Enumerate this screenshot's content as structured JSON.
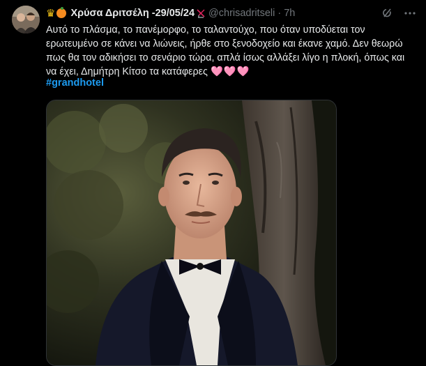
{
  "tweet": {
    "display_name": "Χρύσα Δριτσέλη -29/05/24",
    "handle": "@chrisadritseli",
    "separator": "·",
    "time": "7h",
    "emojis": [
      "crown",
      "orange",
      "no-sign"
    ],
    "text": "Αυτό το πλάσμα, το πανέμορφο, το ταλαντούχο, που όταν υποδύεται τον ερωτευμένο σε κάνει να λιώνεις, ήρθε στο ξενοδοχείο και έκανε χαμό. Δεν θεωρώ πως θα τον αδικήσει το σενάριο τώρα, απλά ίσως αλλάξει λίγο η πλοκή, όπως και να έχει, Δημήτρη Κίτσο τα κατάφερες",
    "hearts": "🩷🩷🩷",
    "hashtag": "#grandhotel"
  },
  "icons": {
    "grok": "grok-icon",
    "more": "more-icon"
  },
  "colors": {
    "background": "#000000",
    "text": "#e7e9ea",
    "secondary": "#71767b",
    "link": "#1d9bf0"
  }
}
